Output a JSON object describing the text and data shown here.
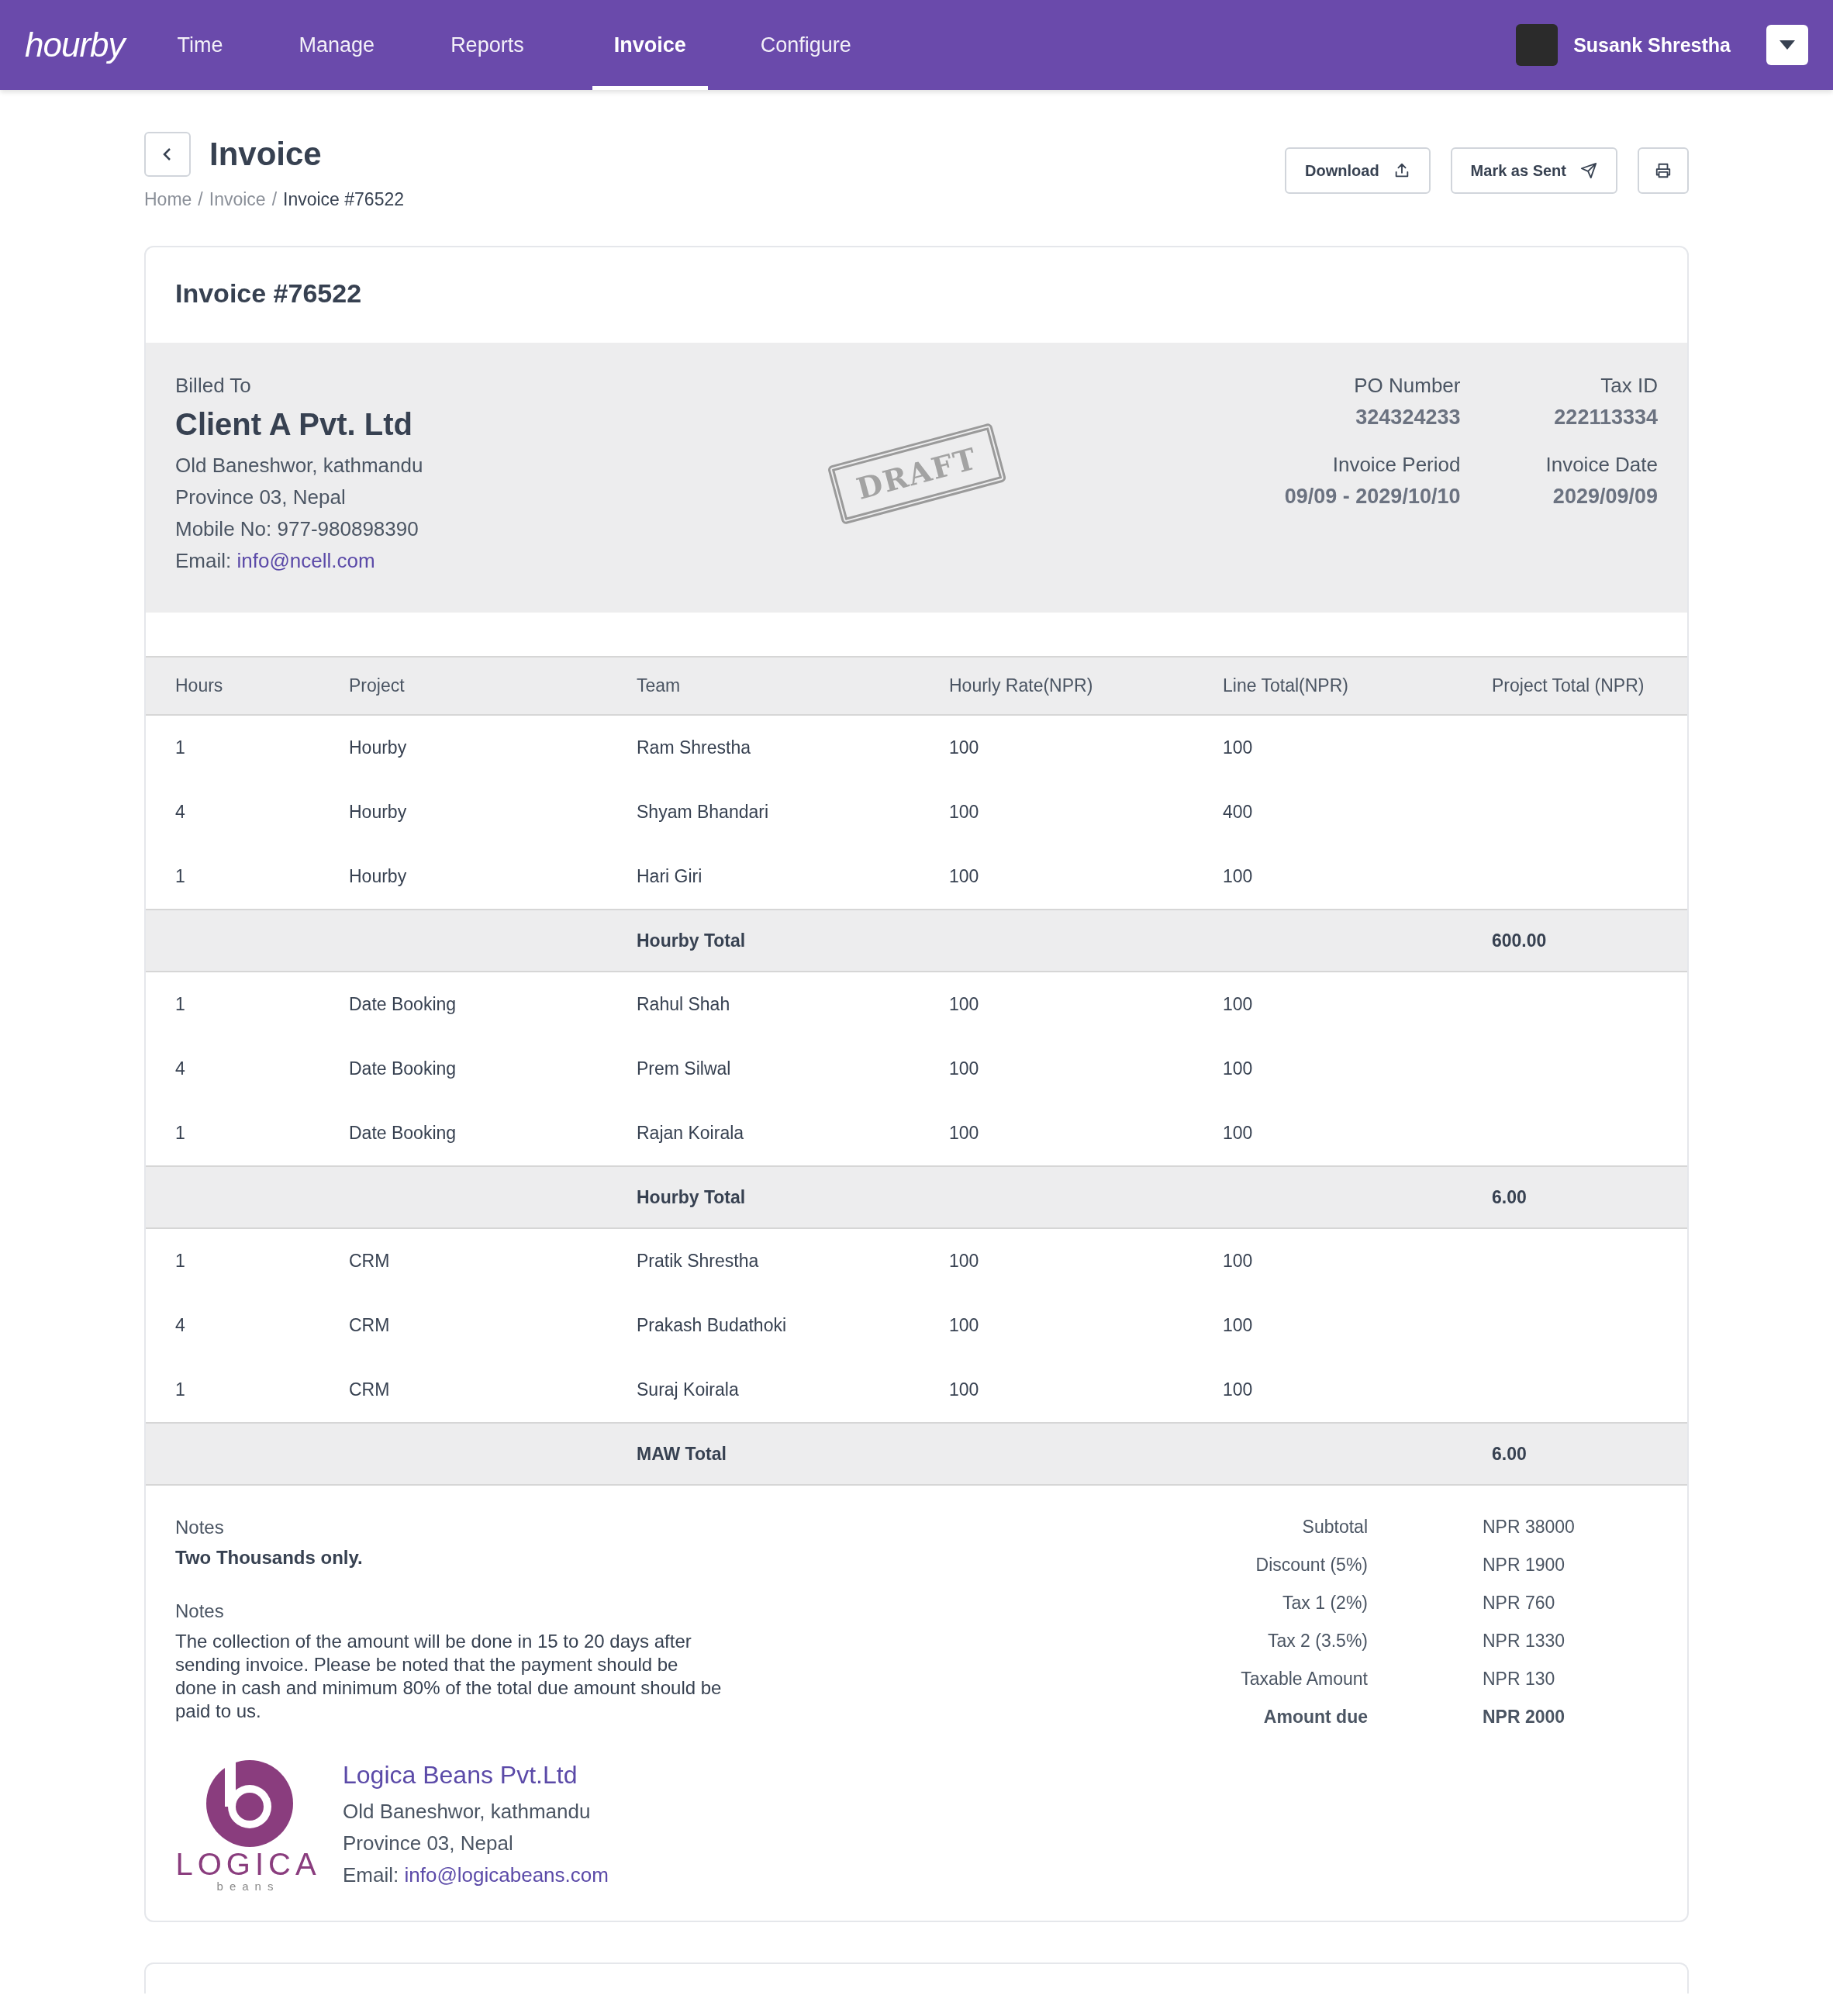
{
  "nav": {
    "brand": "hourby",
    "tabs": [
      {
        "label": "Time",
        "selected": false
      },
      {
        "label": "Manage",
        "selected": false
      },
      {
        "label": "Reports",
        "selected": false
      },
      {
        "label": "Invoice",
        "selected": true
      },
      {
        "label": "Configure",
        "selected": false
      }
    ],
    "user": {
      "name": "Susank Shrestha"
    }
  },
  "header": {
    "title": "Invoice",
    "breadcrumb": [
      {
        "label": "Home",
        "current": false
      },
      {
        "label": "Invoice",
        "current": false
      },
      {
        "label": "Invoice #76522",
        "current": true
      }
    ],
    "separator": "/",
    "actions": [
      {
        "kind": "download",
        "label": "Download"
      },
      {
        "kind": "send",
        "label": "Mark as Sent"
      },
      {
        "kind": "print"
      }
    ]
  },
  "invoice": {
    "title": "Invoice #76522",
    "stamp": "DRAFT",
    "billed_to": {
      "label": "Billed To",
      "name": "Client A Pvt. Ltd",
      "lines": [
        "Old Baneshwor, kathmandu",
        "Province 03, Nepal",
        "Mobile No: 977-980898390"
      ],
      "email_label": "Email:",
      "email": "info@ncell.com"
    },
    "meta": [
      {
        "label": "PO Number",
        "value": "324324233"
      },
      {
        "label": "Tax ID",
        "value": "222113334"
      },
      {
        "label": "Invoice Period",
        "value": "09/09 - 2029/10/10"
      },
      {
        "label": "Invoice Date",
        "value": "2029/09/09"
      }
    ],
    "table": {
      "columns": [
        "Hours",
        "Project",
        "Team",
        "Hourly Rate(NPR)",
        "Line Total(NPR)",
        "Project Total (NPR)"
      ],
      "groups": [
        {
          "rows": [
            [
              "1",
              "Hourby",
              "Ram Shrestha",
              "100",
              "100"
            ],
            [
              "4",
              "Hourby",
              "Shyam Bhandari",
              "100",
              "400"
            ],
            [
              "1",
              "Hourby",
              "Hari Giri",
              "100",
              "100"
            ]
          ],
          "total": {
            "label": "Hourby Total",
            "value": "600.00"
          }
        },
        {
          "rows": [
            [
              "1",
              "Date Booking",
              "Rahul Shah",
              "100",
              "100"
            ],
            [
              "4",
              "Date Booking",
              "Prem Silwal",
              "100",
              "100"
            ],
            [
              "1",
              "Date Booking",
              "Rajan Koirala",
              "100",
              "100"
            ]
          ],
          "total": {
            "label": "Hourby Total",
            "value": "6.00"
          }
        },
        {
          "rows": [
            [
              "1",
              "CRM",
              "Pratik Shrestha",
              "100",
              "100"
            ],
            [
              "4",
              "CRM",
              "Prakash Budathoki",
              "100",
              "100"
            ],
            [
              "1",
              "CRM",
              "Suraj Koirala",
              "100",
              "100"
            ]
          ],
          "total": {
            "label": "MAW Total",
            "value": "6.00"
          }
        }
      ]
    },
    "notes": [
      {
        "label": "Notes",
        "text": "Two Thousands only.",
        "kind": "bold"
      },
      {
        "label": "Notes",
        "text": "The collection of the amount will be done in 15 to 20 days after sending invoice. Please be noted that the payment should be done in cash and minimum 80% of the total due amount should be paid to us.",
        "kind": "plain"
      }
    ],
    "summary": [
      {
        "label": "Subtotal",
        "value": "NPR 38000",
        "kind": "line"
      },
      {
        "label": "Discount (5%)",
        "value": "NPR 1900",
        "kind": "line"
      },
      {
        "label": "Tax 1 (2%)",
        "value": "NPR 760",
        "kind": "line"
      },
      {
        "label": "Tax 2 (3.5%)",
        "value": "NPR 1330",
        "kind": "line"
      },
      {
        "label": "Taxable Amount",
        "value": "NPR 130",
        "kind": "line"
      },
      {
        "label": "Amount due",
        "value": "NPR 2000",
        "kind": "total"
      }
    ],
    "company": {
      "logo_word": "LOGICA",
      "logo_tag": "beans",
      "name": "Logica Beans Pvt.Ltd",
      "lines": [
        "Old Baneshwor, kathmandu",
        "Province 03, Nepal"
      ],
      "email_label": "Email:",
      "email": "info@logicabeans.com"
    }
  }
}
